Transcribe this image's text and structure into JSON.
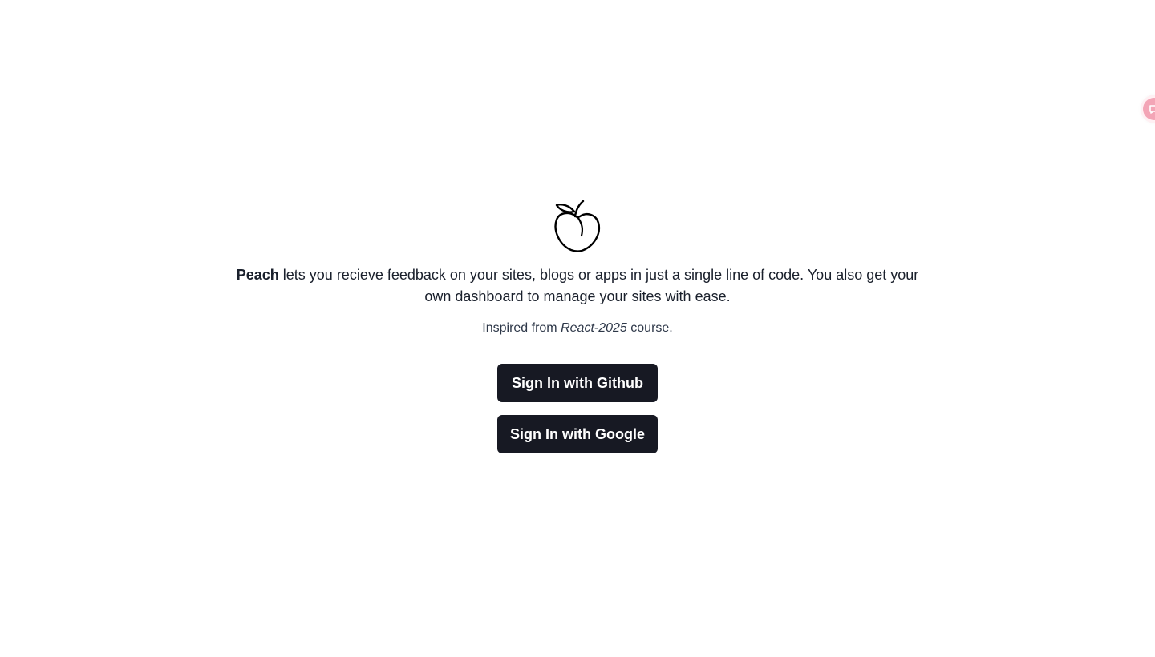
{
  "app": {
    "brand": "Peach",
    "logo_icon": "peach-icon"
  },
  "hero": {
    "brand": "Peach",
    "tagline": "lets you recieve feedback on your sites, blogs or apps in just a single line of code. You also get your own dashboard to manage your sites with ease.",
    "inspired_prefix": "Inspired from",
    "inspired_course": "React-2025",
    "inspired_suffix": "course."
  },
  "auth": {
    "github_label": "Sign In with Github",
    "google_label": "Sign In with Google"
  },
  "feedback_widget": {
    "icon": "feedback-icon",
    "color": "#f3a5b6"
  },
  "colors": {
    "button_bg": "#171923",
    "button_text": "#ffffff",
    "text": "#1a202c"
  }
}
